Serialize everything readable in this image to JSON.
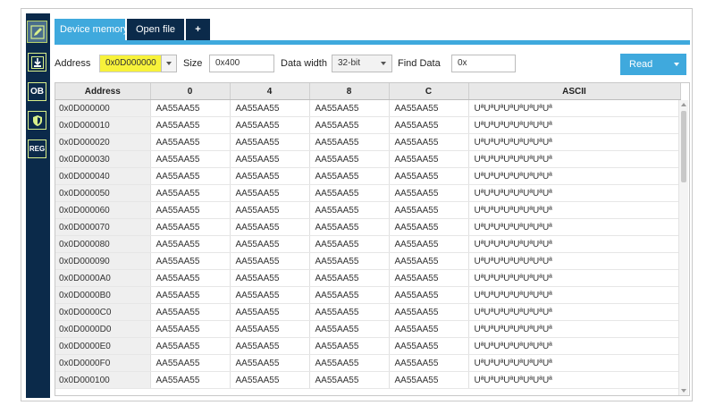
{
  "sidebar": {
    "items": [
      {
        "name": "edit-icon",
        "label": ""
      },
      {
        "name": "download-icon",
        "label": ""
      },
      {
        "name": "ob-icon",
        "label": "OB"
      },
      {
        "name": "shield-icon",
        "label": ""
      },
      {
        "name": "reg-icon",
        "label": "REG"
      }
    ]
  },
  "tabs": [
    {
      "label": "Device memory"
    },
    {
      "label": "Open file"
    },
    {
      "label": "+"
    }
  ],
  "toolbar": {
    "address_label": "Address",
    "address_value": "0x0D000000",
    "size_label": "Size",
    "size_value": "0x400",
    "data_width_label": "Data width",
    "data_width_value": "32-bit",
    "find_label": "Find Data",
    "find_value": "0x",
    "read_label": "Read"
  },
  "table": {
    "columns": [
      "Address",
      "0",
      "4",
      "8",
      "C",
      "ASCII"
    ],
    "rows": [
      [
        "0x0D000000",
        "AA55AA55",
        "AA55AA55",
        "AA55AA55",
        "AA55AA55",
        "UªUªUªUªUªUªUªUª"
      ],
      [
        "0x0D000010",
        "AA55AA55",
        "AA55AA55",
        "AA55AA55",
        "AA55AA55",
        "UªUªUªUªUªUªUªUª"
      ],
      [
        "0x0D000020",
        "AA55AA55",
        "AA55AA55",
        "AA55AA55",
        "AA55AA55",
        "UªUªUªUªUªUªUªUª"
      ],
      [
        "0x0D000030",
        "AA55AA55",
        "AA55AA55",
        "AA55AA55",
        "AA55AA55",
        "UªUªUªUªUªUªUªUª"
      ],
      [
        "0x0D000040",
        "AA55AA55",
        "AA55AA55",
        "AA55AA55",
        "AA55AA55",
        "UªUªUªUªUªUªUªUª"
      ],
      [
        "0x0D000050",
        "AA55AA55",
        "AA55AA55",
        "AA55AA55",
        "AA55AA55",
        "UªUªUªUªUªUªUªUª"
      ],
      [
        "0x0D000060",
        "AA55AA55",
        "AA55AA55",
        "AA55AA55",
        "AA55AA55",
        "UªUªUªUªUªUªUªUª"
      ],
      [
        "0x0D000070",
        "AA55AA55",
        "AA55AA55",
        "AA55AA55",
        "AA55AA55",
        "UªUªUªUªUªUªUªUª"
      ],
      [
        "0x0D000080",
        "AA55AA55",
        "AA55AA55",
        "AA55AA55",
        "AA55AA55",
        "UªUªUªUªUªUªUªUª"
      ],
      [
        "0x0D000090",
        "AA55AA55",
        "AA55AA55",
        "AA55AA55",
        "AA55AA55",
        "UªUªUªUªUªUªUªUª"
      ],
      [
        "0x0D0000A0",
        "AA55AA55",
        "AA55AA55",
        "AA55AA55",
        "AA55AA55",
        "UªUªUªUªUªUªUªUª"
      ],
      [
        "0x0D0000B0",
        "AA55AA55",
        "AA55AA55",
        "AA55AA55",
        "AA55AA55",
        "UªUªUªUªUªUªUªUª"
      ],
      [
        "0x0D0000C0",
        "AA55AA55",
        "AA55AA55",
        "AA55AA55",
        "AA55AA55",
        "UªUªUªUªUªUªUªUª"
      ],
      [
        "0x0D0000D0",
        "AA55AA55",
        "AA55AA55",
        "AA55AA55",
        "AA55AA55",
        "UªUªUªUªUªUªUªUª"
      ],
      [
        "0x0D0000E0",
        "AA55AA55",
        "AA55AA55",
        "AA55AA55",
        "AA55AA55",
        "UªUªUªUªUªUªUªUª"
      ],
      [
        "0x0D0000F0",
        "AA55AA55",
        "AA55AA55",
        "AA55AA55",
        "AA55AA55",
        "UªUªUªUªUªUªUªUª"
      ],
      [
        "0x0D000100",
        "AA55AA55",
        "AA55AA55",
        "AA55AA55",
        "AA55AA55",
        "UªUªUªUªUªUªUªUª"
      ]
    ]
  },
  "colors": {
    "accent": "#3fa9dd",
    "sidebar": "#0b2a4a",
    "address_highlight": "#f7f23a"
  }
}
